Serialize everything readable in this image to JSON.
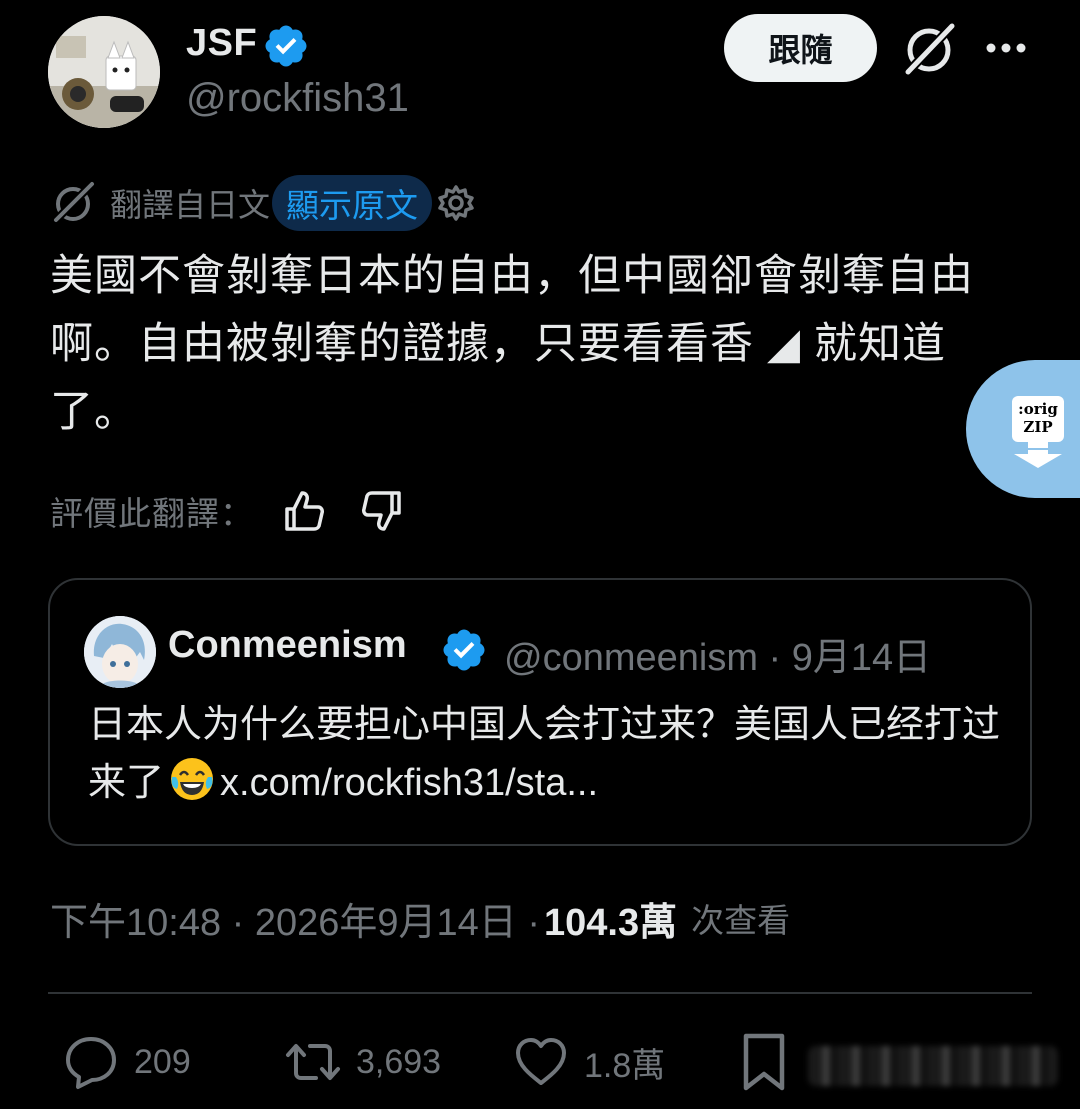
{
  "author": {
    "display_name": "JSF",
    "handle": "@rockfish31",
    "follow_label": "跟隨"
  },
  "translation": {
    "label": "翻譯自日文",
    "show_original": "顯示原文",
    "rate_label": "評價此翻譯："
  },
  "tweet": {
    "text": "美國不會剝奪日本的自由，但中國卻會剝奪自由啊。自由被剝奪的證據，只要看看香 ◢ 就知道了。"
  },
  "zip_widget": {
    "line1": ":orig",
    "line2": "ZIP"
  },
  "quote": {
    "name": "Conmeenism",
    "handle_date": "@conmeenism · 9月14日",
    "text_before_emoji": "日本人为什么要担心中国人会打过来？美国人已经打过来了",
    "link": "x.com/rockfish31/sta..."
  },
  "meta": {
    "timestamp": "下午10:48 · 2026年9月14日 ·",
    "views": "104.3萬",
    "views_label": "次查看"
  },
  "actions": {
    "replies": "209",
    "retweets": "3,693",
    "likes": "1.8萬"
  },
  "colors": {
    "accent": "#1d9bf0",
    "muted": "#71767b",
    "text": "#e7e9ea",
    "border": "#2f3336"
  },
  "icons": [
    "verified-badge-icon",
    "grok-icon",
    "more-icon",
    "translate-icon",
    "settings-icon",
    "thumbs-up-icon",
    "thumbs-down-icon",
    "reply-icon",
    "retweet-icon",
    "like-icon",
    "bookmark-icon",
    "laughing-emoji-icon",
    "download-arrow-icon"
  ]
}
